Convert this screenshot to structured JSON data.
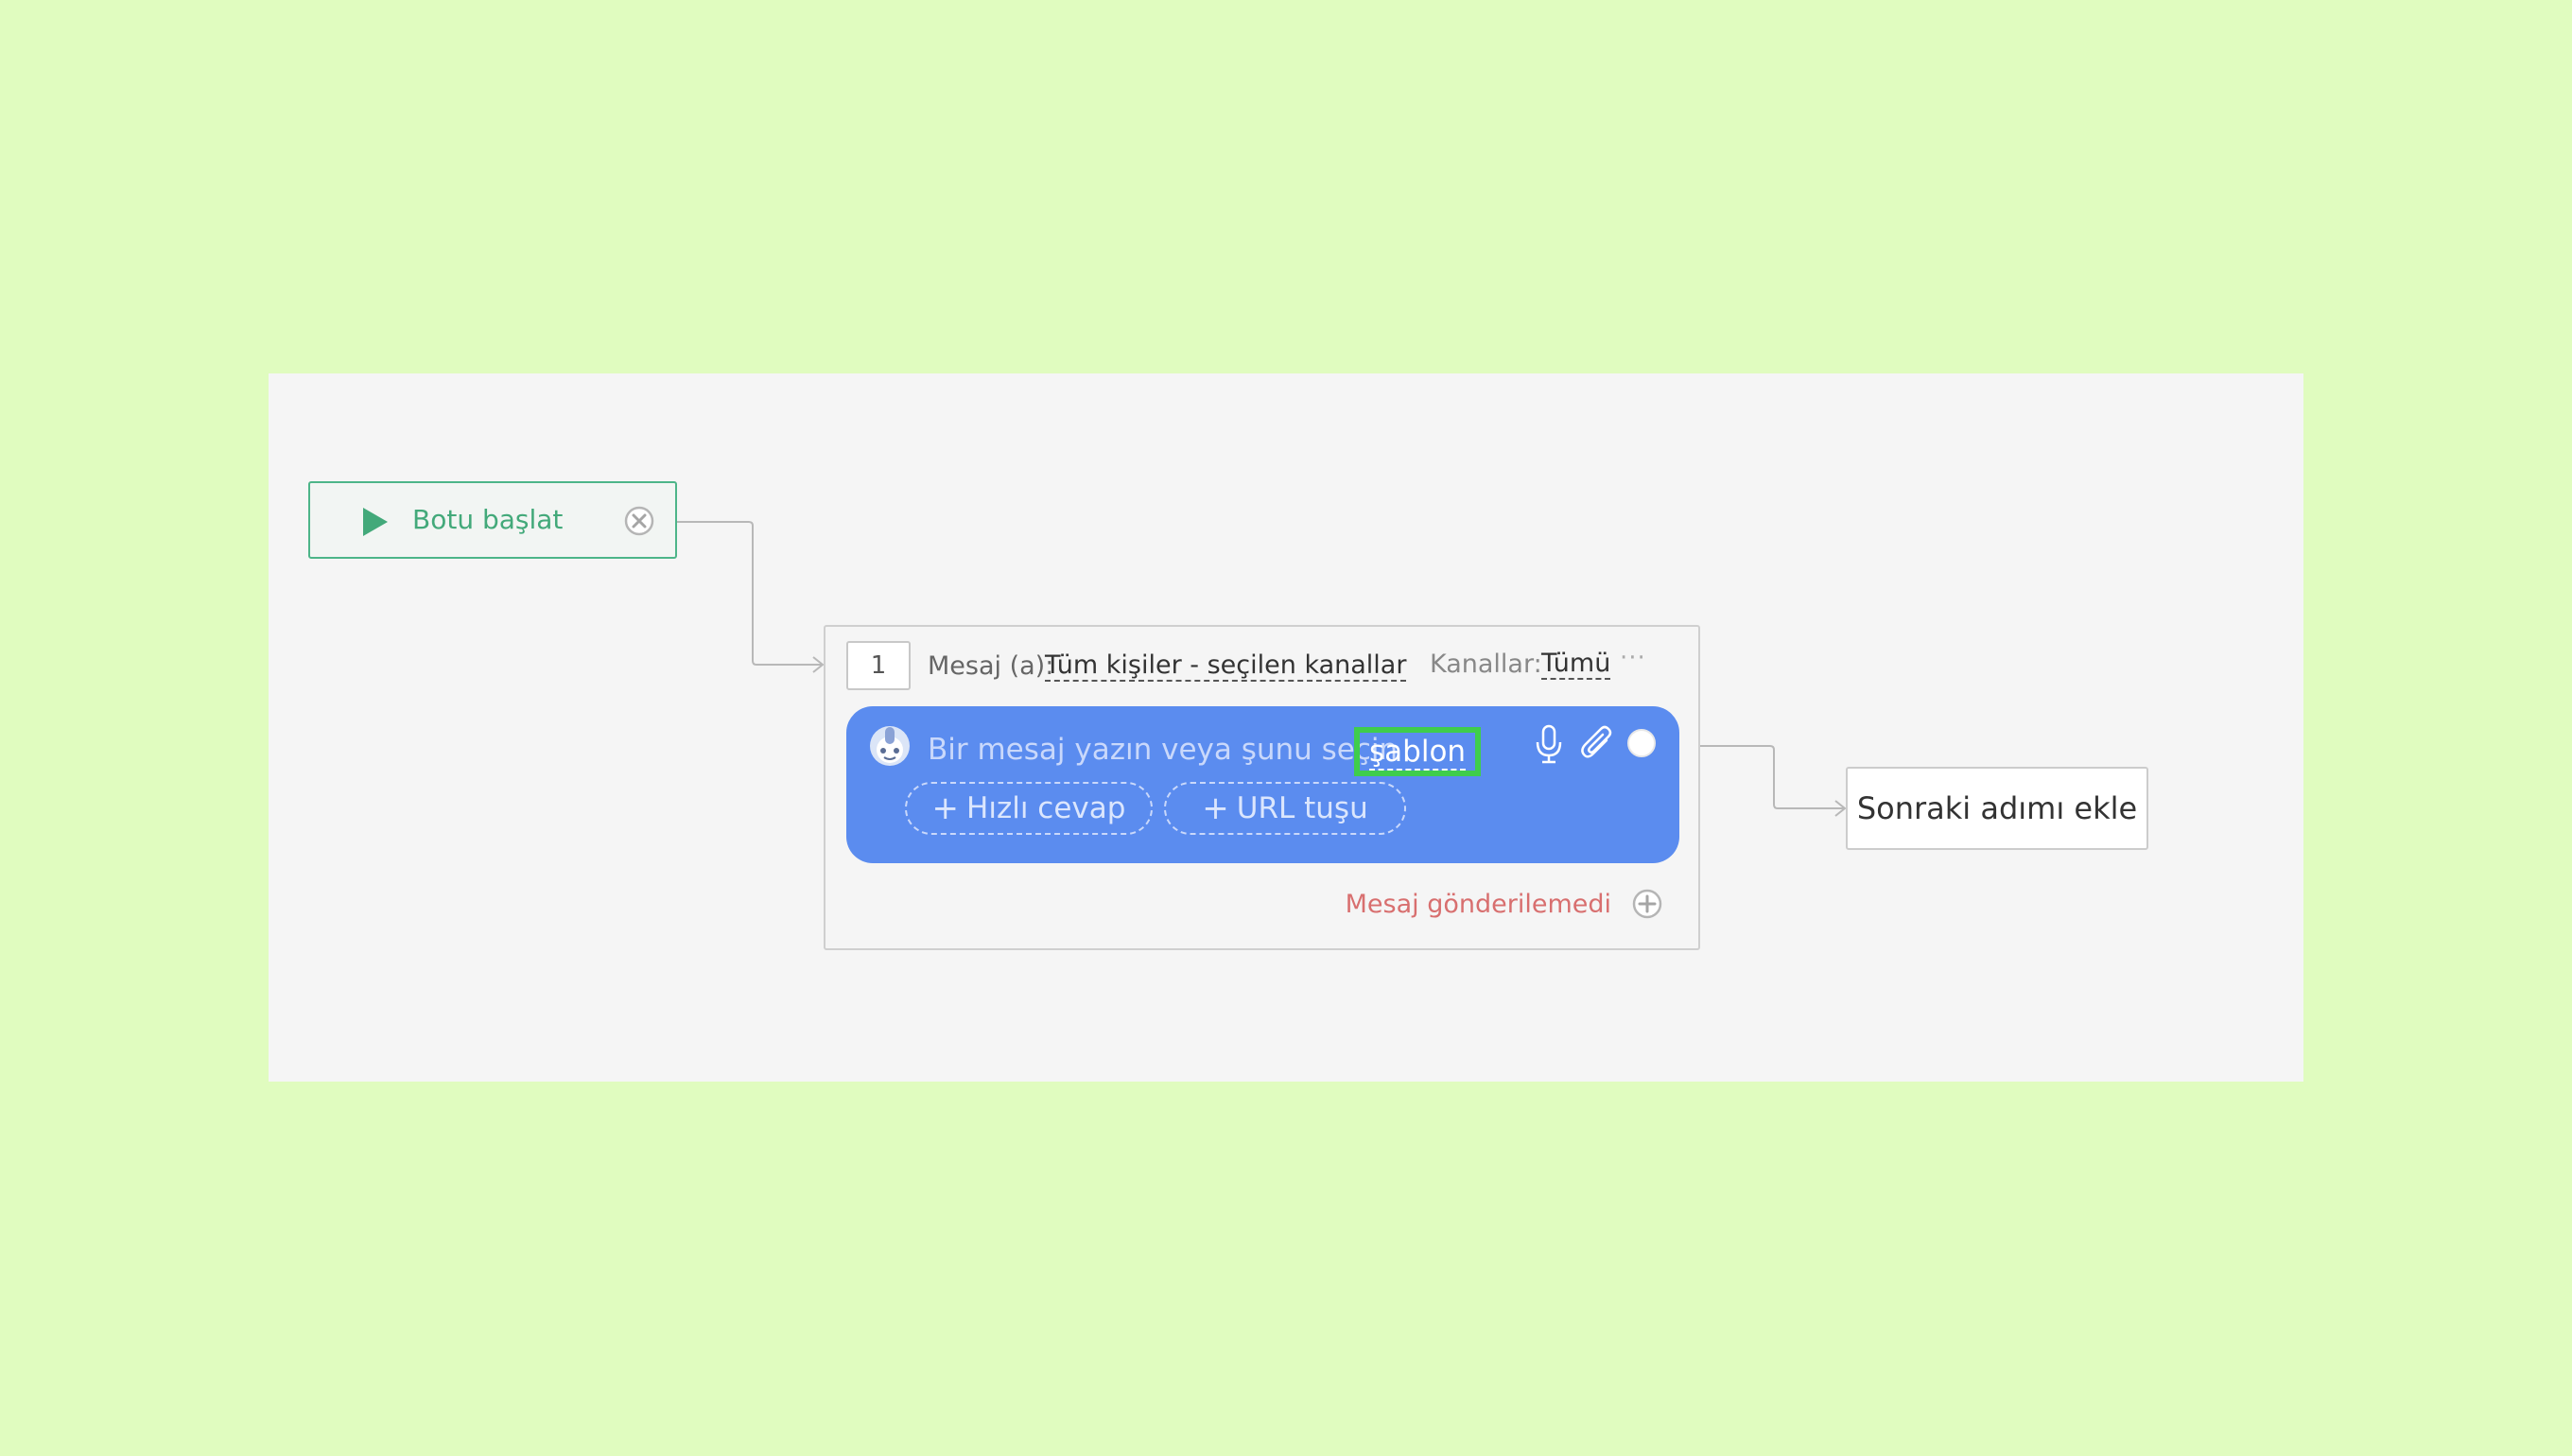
{
  "start": {
    "label": "Botu başlat",
    "icon": "play-icon",
    "accent": "#4db589"
  },
  "message": {
    "step_number": "1",
    "label": "Mesaj (a):",
    "audience": "Tüm kişiler - seçilen kanallar",
    "channels_label": "Kanallar:",
    "channels_value": "Tümü",
    "more": "···",
    "bubble": {
      "placeholder": "Bir mesaj yazın veya şunu seçin",
      "template_link": "şablon",
      "color": "#5b8cef",
      "quick_reply_label": "Hızlı cevap",
      "url_button_label": "URL tuşu"
    },
    "failure_link": "Mesaj gönderilemedi"
  },
  "next_step": {
    "label": "Sonraki adımı ekle"
  }
}
